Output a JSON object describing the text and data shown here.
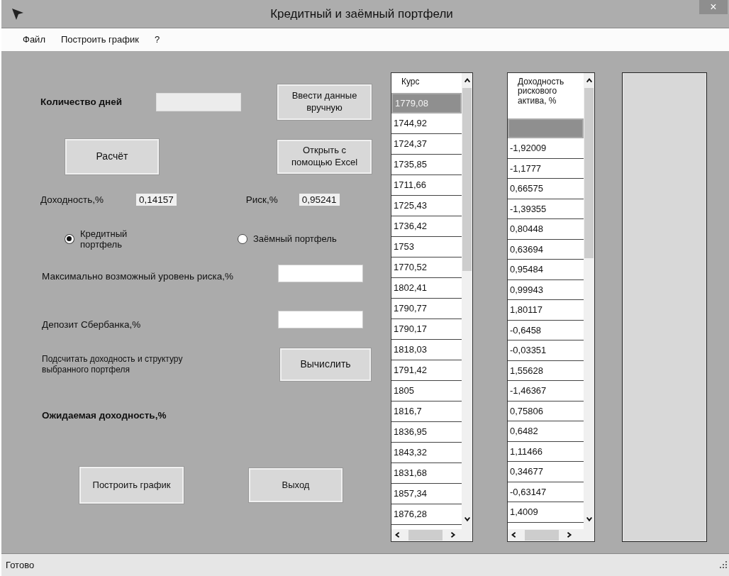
{
  "window": {
    "title": "Кредитный и заёмный портфели",
    "close": "×"
  },
  "menu": [
    "Файл",
    "Построить график",
    "?"
  ],
  "form": {
    "days_label": "Количество дней",
    "manual_button": "Ввести данные вручную",
    "calc_button": "Расчёт",
    "excel_button": "Открыть с помощью Excel",
    "return_label": "Доходность,%",
    "return_value": "0,14157",
    "risk_label": "Риск,%",
    "risk_value": "0,95241",
    "portfolios": [
      {
        "label": "Кредитный портфель",
        "selected": true
      },
      {
        "label": "Заёмный портфель",
        "selected": false
      }
    ],
    "max_risk_label": "Максимально возможный уровень риска,%",
    "deposit_label": "Депозит Сбербанка,%",
    "compute_label": "Подсчитать доходность и структуру выбранного портфеля",
    "compute_button": "Вычислить",
    "expected_label": "Ожидаемая доходность,%",
    "chart_button": "Построить график",
    "exit_button": "Выход"
  },
  "rate_list": {
    "header": "Курс",
    "rows": [
      {
        "text": "1779,08",
        "selected": true
      },
      {
        "text": "1744,92",
        "selected": false
      },
      {
        "text": "1724,37",
        "selected": false
      },
      {
        "text": "1735,85",
        "selected": false
      },
      {
        "text": "1711,66",
        "selected": false
      },
      {
        "text": "1725,43",
        "selected": false
      },
      {
        "text": "1736,42",
        "selected": false
      },
      {
        "text": "1753",
        "selected": false
      },
      {
        "text": "1770,52",
        "selected": false
      },
      {
        "text": "1802,41",
        "selected": false
      },
      {
        "text": "1790,77",
        "selected": false
      },
      {
        "text": "1790,17",
        "selected": false
      },
      {
        "text": "1818,03",
        "selected": false
      },
      {
        "text": "1791,42",
        "selected": false
      },
      {
        "text": "1805",
        "selected": false
      },
      {
        "text": "1816,7",
        "selected": false
      },
      {
        "text": "1836,95",
        "selected": false
      },
      {
        "text": "1843,32",
        "selected": false
      },
      {
        "text": "1831,68",
        "selected": false
      },
      {
        "text": "1857,34",
        "selected": false
      },
      {
        "text": "1876,28",
        "selected": false
      }
    ]
  },
  "return_list": {
    "header": "Доходность рискового актива, %",
    "rows": [
      {
        "selected": true
      },
      {
        "text": "-1,92009",
        "selected": false
      },
      {
        "text": "-1,1777",
        "selected": false
      },
      {
        "text": "0,66575",
        "selected": false
      },
      {
        "text": "-1,39355",
        "selected": false
      },
      {
        "text": "0,80448",
        "selected": false
      },
      {
        "text": "0,63694",
        "selected": false
      },
      {
        "text": "0,95484",
        "selected": false
      },
      {
        "text": "0,99943",
        "selected": false
      },
      {
        "text": "1,80117",
        "selected": false
      },
      {
        "text": "-0,6458",
        "selected": false
      },
      {
        "text": "-0,03351",
        "selected": false
      },
      {
        "text": "1,55628",
        "selected": false
      },
      {
        "text": "-1,46367",
        "selected": false
      },
      {
        "text": "0,75806",
        "selected": false
      },
      {
        "text": "0,6482",
        "selected": false
      },
      {
        "text": "1,11466",
        "selected": false
      },
      {
        "text": "0,34677",
        "selected": false
      },
      {
        "text": "-0,63147",
        "selected": false
      },
      {
        "text": "1,4009",
        "selected": false
      }
    ]
  },
  "status_bar": "Готово"
}
